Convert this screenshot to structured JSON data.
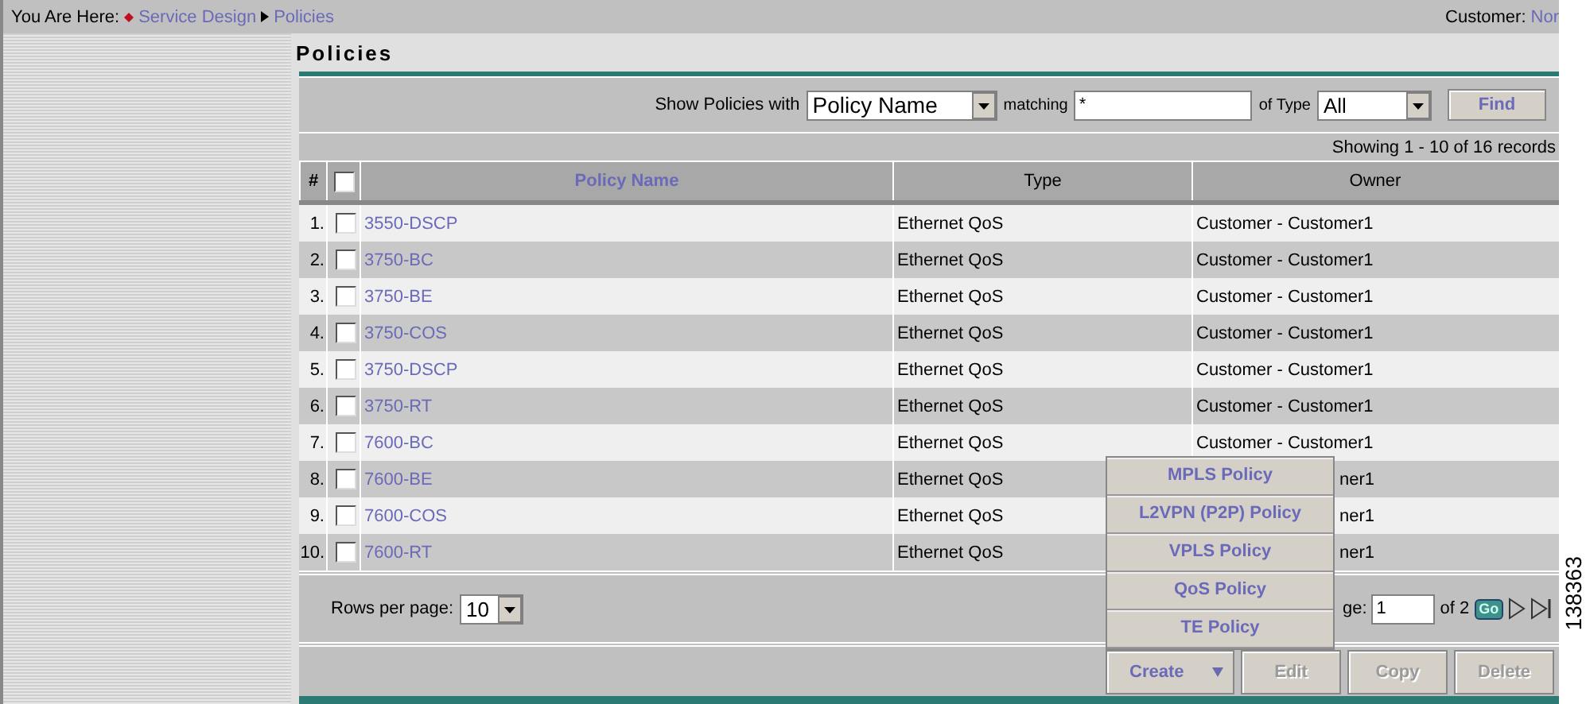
{
  "breadcrumb": {
    "label": "You Are Here:",
    "items": [
      {
        "text": "Service Design"
      },
      {
        "text": "Policies"
      }
    ]
  },
  "customer": {
    "label": "Customer:",
    "value": "Nor"
  },
  "page_title": "Policies",
  "filter": {
    "label": "Show Policies with",
    "field": "Policy Name",
    "matching_label": "matching",
    "matching_value": "*",
    "type_label": "of Type",
    "type_value": "All",
    "find_button": "Find"
  },
  "record_count": "Showing 1 - 10 of 16 records",
  "table": {
    "columns": [
      "#",
      "Policy Name",
      "Type",
      "Owner"
    ],
    "header_checked": false,
    "rows": [
      {
        "index": "1.",
        "checked": false,
        "name": "3550-DSCP",
        "type": "Ethernet QoS",
        "owner": "Customer - Customer1",
        "owner_covered": false
      },
      {
        "index": "2.",
        "checked": false,
        "name": "3750-BC",
        "type": "Ethernet QoS",
        "owner": "Customer - Customer1",
        "owner_covered": false
      },
      {
        "index": "3.",
        "checked": false,
        "name": "3750-BE",
        "type": "Ethernet QoS",
        "owner": "Customer - Customer1",
        "owner_covered": false
      },
      {
        "index": "4.",
        "checked": false,
        "name": "3750-COS",
        "type": "Ethernet QoS",
        "owner": "Customer - Customer1",
        "owner_covered": false
      },
      {
        "index": "5.",
        "checked": false,
        "name": "3750-DSCP",
        "type": "Ethernet QoS",
        "owner": "Customer - Customer1",
        "owner_covered": false
      },
      {
        "index": "6.",
        "checked": false,
        "name": "3750-RT",
        "type": "Ethernet QoS",
        "owner": "Customer - Customer1",
        "owner_covered": false
      },
      {
        "index": "7.",
        "checked": false,
        "name": "7600-BC",
        "type": "Ethernet QoS",
        "owner": "Customer - Customer1",
        "owner_covered": false
      },
      {
        "index": "8.",
        "checked": false,
        "name": "7600-BE",
        "type": "Ethernet QoS",
        "owner": "ner1",
        "owner_covered": true
      },
      {
        "index": "9.",
        "checked": false,
        "name": "7600-COS",
        "type": "Ethernet QoS",
        "owner": "ner1",
        "owner_covered": true
      },
      {
        "index": "10.",
        "checked": false,
        "name": "7600-RT",
        "type": "Ethernet QoS",
        "owner": "ner1",
        "owner_covered": true
      }
    ]
  },
  "pagination": {
    "rows_label": "Rows per page:",
    "rows_value": "10",
    "page_label": "ge:",
    "page_value": "1",
    "of_pages": "of 2",
    "go_button": "Go"
  },
  "buttons": [
    {
      "label": "Create",
      "kind": "menu",
      "disabled": false
    },
    {
      "label": "Edit",
      "kind": "plain",
      "disabled": true
    },
    {
      "label": "Copy",
      "kind": "plain",
      "disabled": true
    },
    {
      "label": "Delete",
      "kind": "plain",
      "disabled": true
    }
  ],
  "create_menu": {
    "expanded": true,
    "items": [
      "MPLS Policy",
      "L2VPN (P2P) Policy",
      "VPLS Policy",
      "QoS Policy",
      "TE Policy"
    ]
  },
  "figure_number": "138363"
}
